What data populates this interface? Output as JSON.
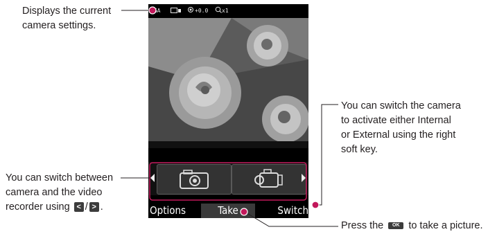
{
  "callouts": {
    "settings": [
      "Displays the current",
      "camera settings."
    ],
    "switch_camera": [
      "You can switch the camera",
      "to activate either Internal",
      "or External using the right",
      "soft key."
    ],
    "switch_mode": {
      "line1": "You can switch between",
      "line2": "camera and the video",
      "line3_prefix": "recorder using",
      "key_left": "<",
      "separator": "/",
      "key_right": ">",
      "line3_suffix": "."
    },
    "take_picture": {
      "prefix": "Press the",
      "key": "OK",
      "suffix": "to take a picture."
    }
  },
  "phone": {
    "status": {
      "resolution": "XGA",
      "quality": "",
      "brightness": "+0.0",
      "zoom": "x1"
    },
    "softkeys": {
      "left": "Options",
      "center": "Take",
      "right": "Switch"
    },
    "modes": {
      "camera_icon": "camera-icon",
      "video_icon": "camcorder-icon"
    }
  },
  "colors": {
    "text": "#231f20",
    "leader_dot": "#c2185b",
    "screen_bg": "#000000",
    "pink_frame": "#c2185b"
  }
}
